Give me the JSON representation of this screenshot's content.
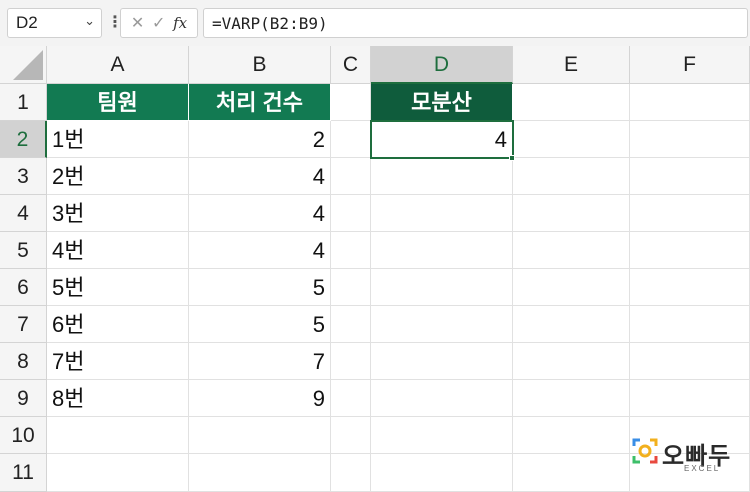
{
  "formula_bar": {
    "name_box": "D2",
    "fx_label": "fx",
    "formula": "=VARP(B2:B9)"
  },
  "columns": [
    "A",
    "B",
    "C",
    "D",
    "E",
    "F"
  ],
  "rows": [
    "1",
    "2",
    "3",
    "4",
    "5",
    "6",
    "7",
    "8",
    "9",
    "10",
    "11"
  ],
  "table": {
    "header_team": "팀원",
    "header_count": "처리 건수",
    "members": [
      "1번",
      "2번",
      "3번",
      "4번",
      "5번",
      "6번",
      "7번",
      "8번"
    ],
    "counts": [
      "2",
      "4",
      "4",
      "4",
      "5",
      "5",
      "7",
      "9"
    ]
  },
  "result": {
    "header": "모분산",
    "value": "4"
  },
  "logo": {
    "text": "오빠두",
    "sub": "EXCEL"
  },
  "colors": {
    "header_green": "#127a52",
    "result_header_green": "#0f5c3c",
    "selection_green": "#1e6e3e"
  }
}
